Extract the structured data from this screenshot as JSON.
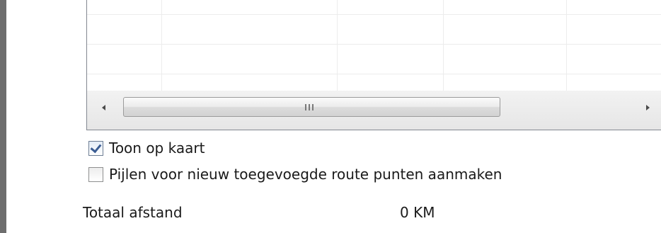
{
  "route_grid": {
    "horizontal_scrollbar": {
      "grip_icon": "scroll-grip-icon",
      "left_arrow_icon": "scroll-left-arrow-icon",
      "right_arrow_icon": "scroll-right-arrow-icon",
      "thumb_length_fraction": 0.67
    }
  },
  "options": {
    "show_on_map": {
      "label": "Toon op kaart",
      "checked": true
    },
    "create_arrows": {
      "label": "Pijlen voor nieuw toegevoegde route punten aanmaken",
      "checked": false
    }
  },
  "total": {
    "label": "Totaal afstand",
    "value": "0 KM"
  },
  "colors": {
    "check_accent": "#3b5d93",
    "panel_border": "#828790"
  }
}
